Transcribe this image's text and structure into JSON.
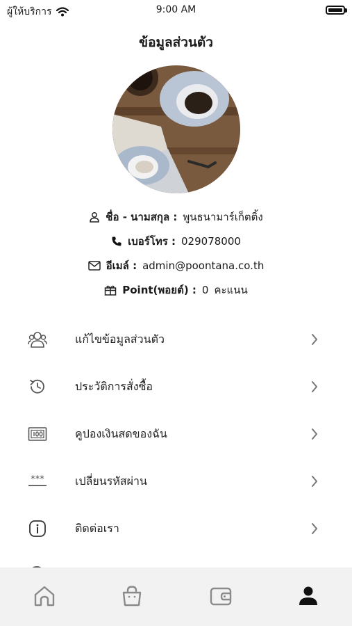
{
  "status_bar": {
    "carrier": "ผู้ให้บริการ",
    "time": "9:00 AM"
  },
  "header": {
    "title": "ข้อมูลส่วนตัว"
  },
  "profile": {
    "name_label": "ชื่อ - นามสกุล :",
    "name_value": "พูนธนามาร์เก็ตติ้ง",
    "phone_label": "เบอร์โทร :",
    "phone_value": "029078000",
    "email_label": "อีเมล์ :",
    "email_value": "admin@poontana.co.th",
    "point_label": "Point(พอยต์) :",
    "point_value": "0",
    "point_unit": "คะแนน"
  },
  "menu": [
    {
      "label": "แก้ไขข้อมูลส่วนตัว",
      "icon": "users-icon"
    },
    {
      "label": "ประวัติการสั่งซื้อ",
      "icon": "history-icon"
    },
    {
      "label": "คูปองเงินสดของฉัน",
      "icon": "coupon-icon"
    },
    {
      "label": "เปลี่ยนรหัสผ่าน",
      "icon": "password-icon"
    },
    {
      "label": "ติดต่อเรา",
      "icon": "info-icon"
    }
  ],
  "bottom_nav": [
    {
      "icon": "home-icon",
      "active": false
    },
    {
      "icon": "bag-icon",
      "active": false
    },
    {
      "icon": "wallet-icon",
      "active": false
    },
    {
      "icon": "profile-icon",
      "active": true
    }
  ],
  "colors": {
    "background": "#ffffff",
    "nav_background": "#f2f2f2",
    "active_icon": "#111111",
    "inactive_icon": "#8a8a8a"
  }
}
